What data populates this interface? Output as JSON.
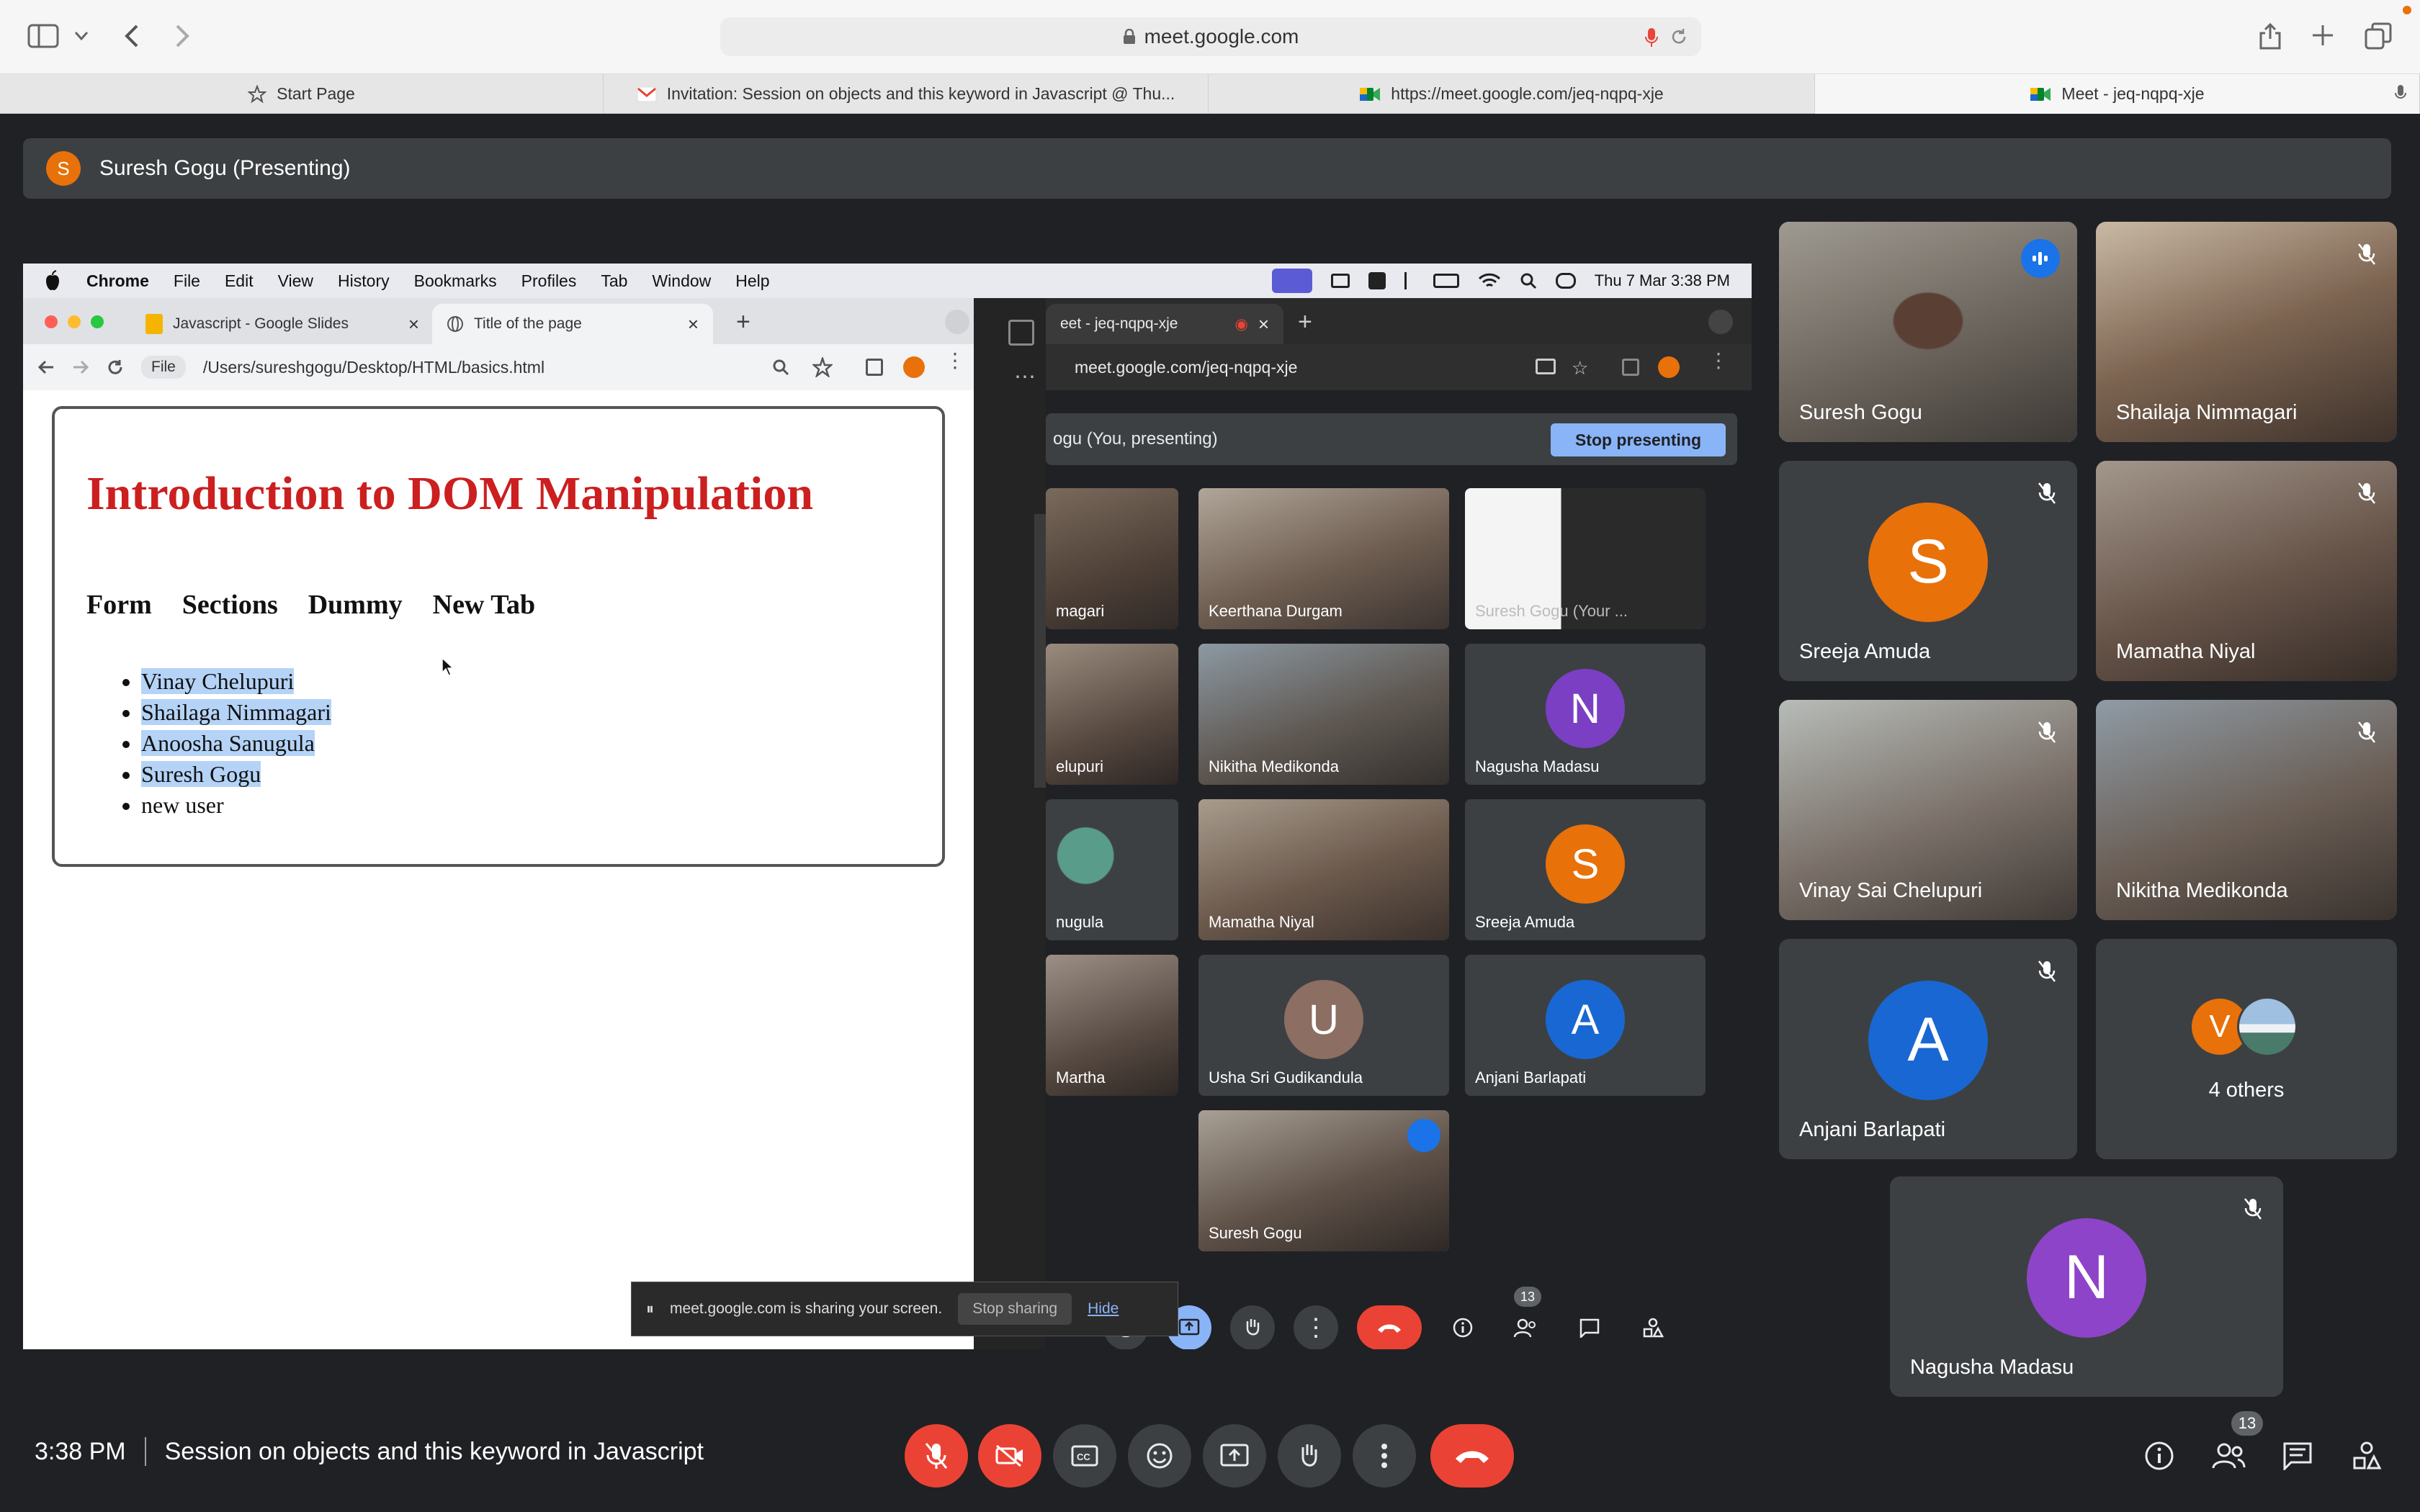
{
  "safari": {
    "url": "meet.google.com",
    "tabs": [
      {
        "label": "Start Page",
        "icon": "star-icon"
      },
      {
        "label": "Invitation: Session on objects and this keyword in Javascript @ Thu...",
        "icon": "gmail-icon"
      },
      {
        "label": "https://meet.google.com/jeq-nqpq-xje",
        "icon": "meet-icon"
      },
      {
        "label": "Meet - jeq-nqpq-xje",
        "icon": "meet-icon"
      }
    ]
  },
  "presenter": {
    "initial": "S",
    "label": "Suresh Gogu (Presenting)"
  },
  "shared": {
    "menubar": [
      "Chrome",
      "File",
      "Edit",
      "View",
      "History",
      "Bookmarks",
      "Profiles",
      "Tab",
      "Window",
      "Help"
    ],
    "clock": "Thu 7 Mar  3:38 PM",
    "left_tabs": [
      "Javascript - Google Slides",
      "Title of the page"
    ],
    "left_file_label": "File",
    "left_path": "/Users/sureshgogu/Desktop/HTML/basics.html",
    "page": {
      "title": "Introduction to DOM Manipulation",
      "nav": [
        "Form",
        "Sections",
        "Dummy",
        "New Tab"
      ],
      "list": [
        "Vinay Chelupuri",
        "Shailaga Nimmagari",
        "Anoosha Sanugula",
        "Suresh Gogu",
        "new user"
      ]
    },
    "right_tab": "eet - jeq-nqpq-xje",
    "right_url": "meet.google.com/jeq-nqpq-xje",
    "inner_presenting": "ogu (You, presenting)",
    "stop_presenting": "Stop presenting",
    "inner_tiles": [
      {
        "name": "magari"
      },
      {
        "name": "Keerthana Durgam"
      },
      {
        "name": "Suresh Gogu (Your ..."
      },
      {
        "name": "elupuri"
      },
      {
        "name": "Nikitha Medikonda"
      },
      {
        "name": "Nagusha Madasu",
        "initial": "N"
      },
      {
        "name": "nugula"
      },
      {
        "name": "Mamatha Niyal"
      },
      {
        "name": "Sreeja Amuda",
        "initial": "S"
      },
      {
        "name": "Martha"
      },
      {
        "name": "Usha Sri Gudikandula",
        "initial": "U"
      },
      {
        "name": "Anjani Barlapati",
        "initial": "A"
      },
      {
        "name": "Suresh Gogu"
      }
    ],
    "inner_people_count": "13",
    "share_notice": "meet.google.com is sharing your screen.",
    "stop_sharing": "Stop sharing",
    "hide": "Hide"
  },
  "tiles": [
    {
      "name": "Suresh Gogu",
      "type": "video",
      "speaking": true
    },
    {
      "name": "Shailaja Nimmagari",
      "type": "video",
      "muted": true
    },
    {
      "name": "Sreeja Amuda",
      "type": "avatar",
      "initial": "S",
      "color": "#e8710a",
      "muted": true
    },
    {
      "name": "Mamatha Niyal",
      "type": "video",
      "muted": true
    },
    {
      "name": "Vinay Sai Chelupuri",
      "type": "video",
      "muted": true
    },
    {
      "name": "Nikitha Medikonda",
      "type": "video",
      "muted": true
    },
    {
      "name": "Anjani Barlapati",
      "type": "avatar",
      "initial": "A",
      "color": "#1967d2",
      "muted": true
    },
    {
      "name": "4 others",
      "type": "others",
      "initial": "V"
    },
    {
      "name": "Nagusha Madasu",
      "type": "avatar",
      "initial": "N",
      "color": "#8e44c9",
      "muted": true
    }
  ],
  "bottom": {
    "time": "3:38 PM",
    "meeting_title": "Session on objects and this keyword in Javascript",
    "people_count": "13"
  },
  "colors": {
    "meet_bg": "#202124",
    "tile_bg": "#3c4043",
    "danger": "#ea4335",
    "accent": "#8ab4f8"
  }
}
